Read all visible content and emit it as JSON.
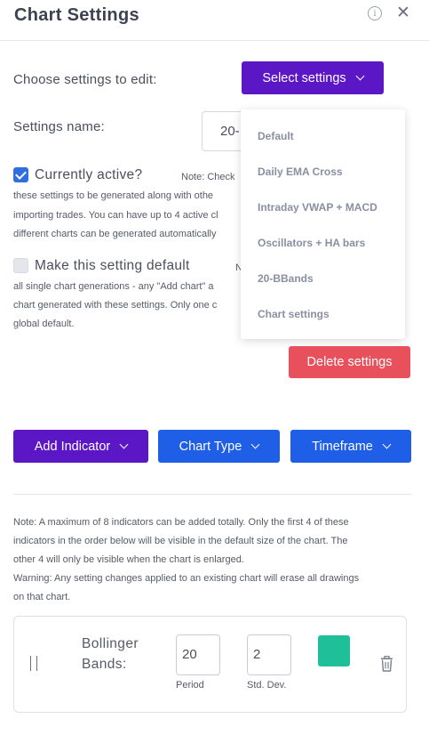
{
  "header": {
    "title": "Chart Settings"
  },
  "settings": {
    "choose_label": "Choose settings to edit:",
    "select_button": "Select settings",
    "name_label": "Settings name:",
    "name_value": "20-",
    "active_label": "Currently active?",
    "active_checked": true,
    "active_note": "Note: Check",
    "active_note_lines": [
      "these settings to be generated along with othe",
      "importing trades. You can have up to 4 active cl",
      "different charts can be generated automatically"
    ],
    "default_label": "Make this setting default",
    "default_checked": false,
    "default_note": "N",
    "default_note_lines": [
      "all single chart generations - any \"Add chart\" a",
      "chart generated with these settings. Only one c",
      "global default."
    ],
    "delete_button": "Delete settings"
  },
  "dropdown": {
    "items": [
      "Default",
      "Daily EMA Cross",
      "Intraday VWAP + MACD",
      "Oscillators + HA bars",
      "20-BBands",
      "Chart settings"
    ]
  },
  "toolbar": {
    "add_indicator": "Add Indicator",
    "chart_type": "Chart Type",
    "timeframe": "Timeframe"
  },
  "notes": {
    "lines": [
      "Note: A maximum of 8 indicators can be added totally. Only the first 4 of these",
      "indicators in the order below will be visible in the default size of the chart. The",
      "other 4 will only be visible when the chart is enlarged.",
      "Warning: Any setting changes applied to an existing chart will erase all drawings",
      "on that chart."
    ]
  },
  "indicator": {
    "name_line1": "Bollinger",
    "name_line2": "Bands:",
    "period_value": "20",
    "period_label": "Period",
    "stddev_value": "2",
    "stddev_label": "Std. Dev.",
    "color": "#1fbf9a"
  },
  "colors": {
    "purple": "#5b16c6",
    "blue": "#1f5ee6",
    "red": "#e8515b",
    "checkbox_blue": "#2f6fe0"
  },
  "icons": [
    "info-icon",
    "close-icon",
    "chevron-down-icon",
    "drag-handle-icon",
    "trash-icon"
  ]
}
